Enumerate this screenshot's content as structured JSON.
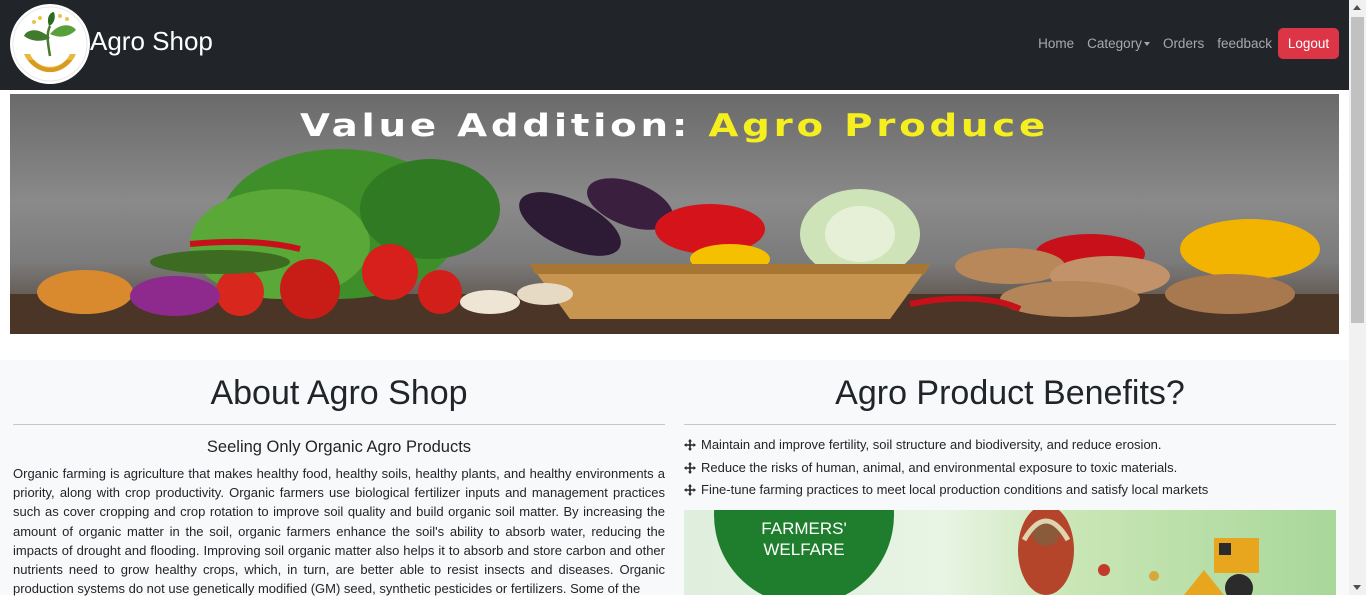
{
  "navbar": {
    "brand": "Agro Shop",
    "links": {
      "home": "Home",
      "category": "Category",
      "orders": "Orders",
      "feedback": "feedback"
    },
    "logout": "Logout"
  },
  "banner": {
    "title_part1": "Value Addition: ",
    "title_part2": "Agro Produce"
  },
  "about": {
    "heading": "About Agro Shop",
    "subheading": "Seeling Only Organic Agro Products",
    "paragraph": "Organic farming is agriculture that makes healthy food, healthy soils, healthy plants, and healthy environments a priority, along with crop productivity. Organic farmers use biological fertilizer inputs and management practices such as cover cropping and crop rotation to improve soil quality and build organic soil matter. By increasing the amount of organic matter in the soil, organic farmers enhance the soil's ability to absorb water, reducing the impacts of drought and flooding. Improving soil organic matter also helps it to absorb and store carbon and other nutrients need to grow healthy crops, which, in turn, are better able to resist insects and diseases. Organic production systems do not use genetically modified (GM) seed, synthetic pesticides or fertilizers. Some of the"
  },
  "benefits": {
    "heading": "Agro Product Benefits?",
    "items": [
      "Maintain and improve fertility, soil structure and biodiversity, and reduce erosion.",
      "Reduce the risks of human, animal, and environmental exposure to toxic materials.",
      "Fine-tune farming practices to meet local production conditions and satisfy local markets"
    ],
    "image_text_line1": "FARMERS'",
    "image_text_line2": "WELFARE"
  },
  "colors": {
    "navbar_bg": "#212529",
    "logout_bg": "#dc3545",
    "banner_highlight": "#f5ef1f",
    "content_bg": "#f8f9fa"
  }
}
